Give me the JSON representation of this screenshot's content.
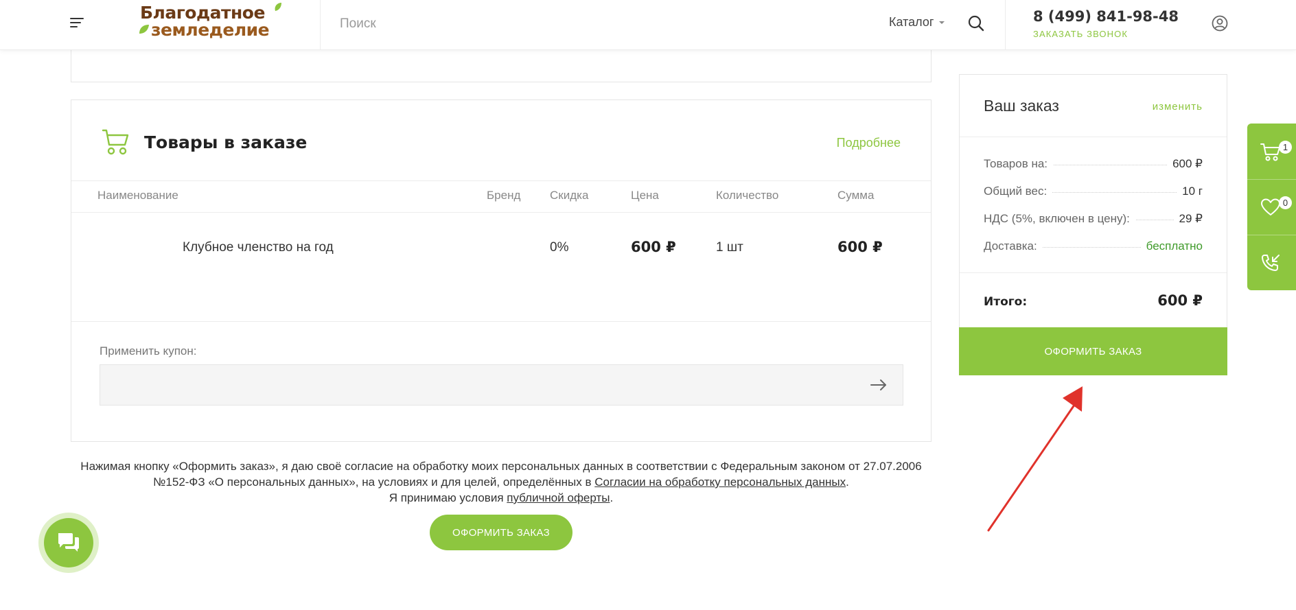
{
  "header": {
    "logo_line1": "Благодатное",
    "logo_line2": "земледелие",
    "search_placeholder": "Поиск",
    "catalog_label": "Каталог",
    "phone": "8 (499) 841-98-48",
    "callback_label": "ЗАКАЗАТЬ ЗВОНОК"
  },
  "goods": {
    "title": "Товары в заказе",
    "more_link": "Подробнее",
    "columns": {
      "name": "Наименование",
      "brand": "Бренд",
      "discount": "Скидка",
      "price": "Цена",
      "quantity": "Количество",
      "sum": "Сумма"
    },
    "rows": [
      {
        "name": "Клубное членство на год",
        "brand": "",
        "discount": "0%",
        "price": "600 ₽",
        "quantity": "1 шт",
        "sum": "600 ₽"
      }
    ],
    "coupon_label": "Применить купон:",
    "coupon_value": ""
  },
  "disclaimer": {
    "text_before_link1": "Нажимая кнопку «Оформить заказ», я даю своё согласие на обработку моих персональных данных в соответствии с Федеральным законом от 27.07.2006 №152-ФЗ «О персональных данных», на условиях и для целей, определённых в ",
    "link1": "Согласии на обработку персональных данных",
    "text_after_link1": ".",
    "text_before_link2": "Я принимаю условия ",
    "link2": "публичной оферты",
    "text_after_link2": "."
  },
  "submit_bottom_label": "ОФОРМИТЬ ЗАКАЗ",
  "summary": {
    "title": "Ваш заказ",
    "change_link": "изменить",
    "rows": [
      {
        "label": "Товаров на:",
        "value": "600 ₽"
      },
      {
        "label": "Общий вес:",
        "value": "10 г"
      },
      {
        "label": "НДС (5%, включен в цену):",
        "value": "29 ₽"
      },
      {
        "label": "Доставка:",
        "value": "бесплатно"
      }
    ],
    "total_label": "Итого:",
    "total_value": "600 ₽",
    "button_label": "ОФОРМИТЬ ЗАКАЗ"
  },
  "side_panel": {
    "cart_count": "1",
    "favorites_count": "0"
  },
  "colors": {
    "accent": "#8dc63f",
    "annotation": "#e0322b",
    "logo_brown": "#6b3a16"
  },
  "icons": {
    "menu": "hamburger-icon",
    "search": "search-icon",
    "user": "user-icon",
    "cart": "cart-icon",
    "heart": "heart-icon",
    "callback": "phone-callback-icon",
    "chat": "chat-icon",
    "arrow": "arrow-right-icon"
  }
}
